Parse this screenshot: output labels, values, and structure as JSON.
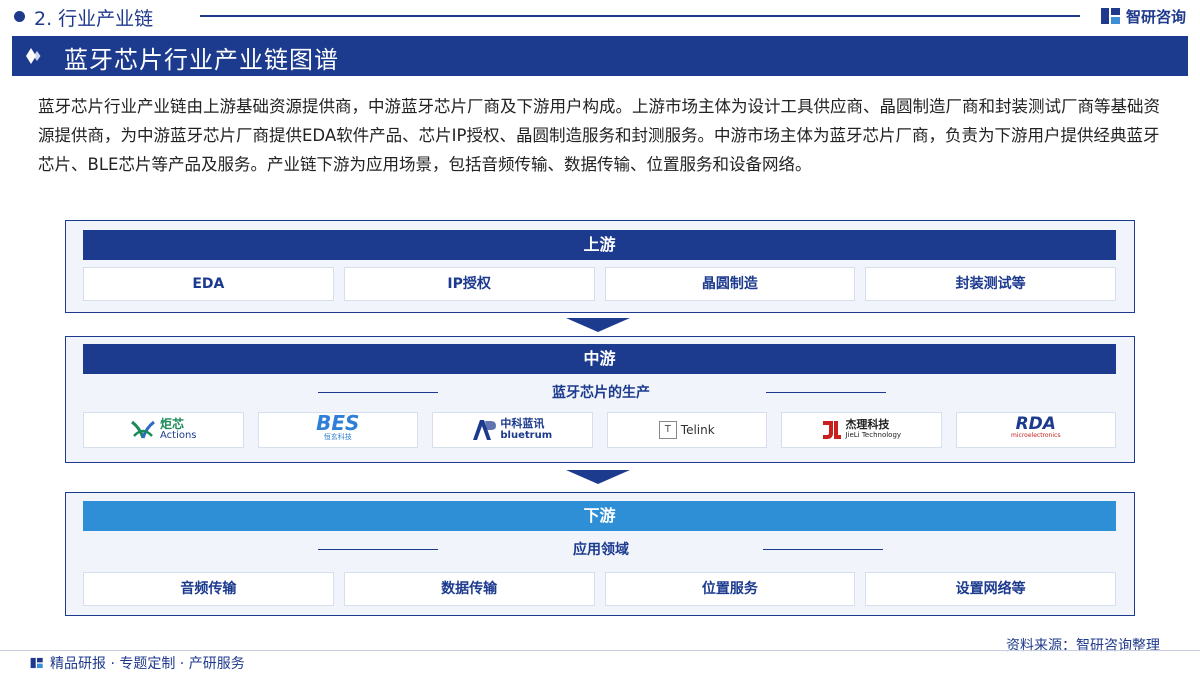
{
  "header": {
    "section": "2. 行业产业链",
    "brand": "智研咨询"
  },
  "title": "蓝牙芯片行业产业链图谱",
  "intro": "蓝牙芯片行业产业链由上游基础资源提供商，中游蓝牙芯片厂商及下游用户构成。上游市场主体为设计工具供应商、晶圆制造厂商和封装测试厂商等基础资源提供商，为中游蓝牙芯片厂商提供EDA软件产品、芯片IP授权、晶圆制造服务和封测服务。中游市场主体为蓝牙芯片厂商，负责为下游用户提供经典蓝牙芯片、BLE芯片等产品及服务。产业链下游为应用场景，包括音频传输、数据传输、位置服务和设备网络。",
  "upstream": {
    "label": "上游",
    "items": [
      "EDA",
      "IP授权",
      "晶圆制造",
      "封装测试等"
    ]
  },
  "midstream": {
    "label": "中游",
    "subtitle": "蓝牙芯片的生产",
    "logos": [
      {
        "icon": "actions-logo",
        "text": "炬芯",
        "sub": "Actions"
      },
      {
        "icon": "bes-logo",
        "text": "BES",
        "sub": "恒玄科技"
      },
      {
        "icon": "bluetrum-logo",
        "text": "中科蓝讯",
        "sub": "bluetrum"
      },
      {
        "icon": "telink-logo",
        "text": "Telink",
        "sub": ""
      },
      {
        "icon": "jieli-logo",
        "text": "杰理科技",
        "sub": "JieLi Technology"
      },
      {
        "icon": "rda-logo",
        "text": "RDA",
        "sub": "microelectronics"
      }
    ]
  },
  "downstream": {
    "label": "下游",
    "subtitle": "应用领域",
    "items": [
      "音频传输",
      "数据传输",
      "位置服务",
      "设置网络等"
    ]
  },
  "footer": {
    "source": "资料来源：智研咨询整理",
    "slogan": "精品研报 · 专题定制 · 产研服务"
  },
  "colors": {
    "primary": "#1c3a8e",
    "light_band": "#2f8fd6",
    "panel_bg": "#f1f4fb"
  }
}
